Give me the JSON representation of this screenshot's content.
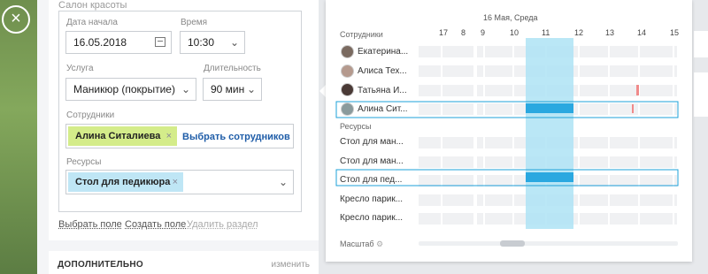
{
  "modal": {
    "close_glyph": "×"
  },
  "form": {
    "section_title": "Салон красоты",
    "date_label": "Дата начала",
    "date_value": "16.05.2018",
    "time_label": "Время",
    "time_value": "10:30",
    "service_label": "Услуга",
    "service_value": "Маникюр (покрытие)",
    "duration_label": "Длительность",
    "duration_value": "90 мин",
    "staff_label": "Сотрудники",
    "staff_chip": "Алина Ситалиева",
    "staff_link": "Выбрать сотрудников",
    "resources_label": "Ресурсы",
    "resource_chip": "Стол для педикюра",
    "chip_close": "×",
    "chevron": "⌄",
    "links": {
      "select_field": "Выбрать поле",
      "create_field": "Создать поле",
      "delete_section": "Удалить раздел"
    }
  },
  "extra": {
    "title": "ДОПОЛНИТЕЛЬНО",
    "edit": "изменить"
  },
  "schedule": {
    "date_header": "16 Мая, Среда",
    "hours": [
      "17",
      "8",
      "9",
      "10",
      "11",
      "12",
      "13",
      "14",
      "15"
    ],
    "staff_group": "Сотрудники",
    "staff": [
      "Екатерина...",
      "Алиса Тех...",
      "Татьяна И...",
      "Алина Сит..."
    ],
    "resources_group": "Ресурсы",
    "resources": [
      "Стол для ман...",
      "Стол для ман...",
      "Стол для пед...",
      "Кресло парик...",
      "Кресло парик..."
    ],
    "scale_label": "Масштаб",
    "colors": {
      "accent": "#1ea0d8",
      "selection": "#aee3f5",
      "booking": "#2aa8e0",
      "chip_green": "#d4ec8a",
      "chip_blue": "#bfe6f5",
      "busy_red": "#f08a8a"
    }
  }
}
